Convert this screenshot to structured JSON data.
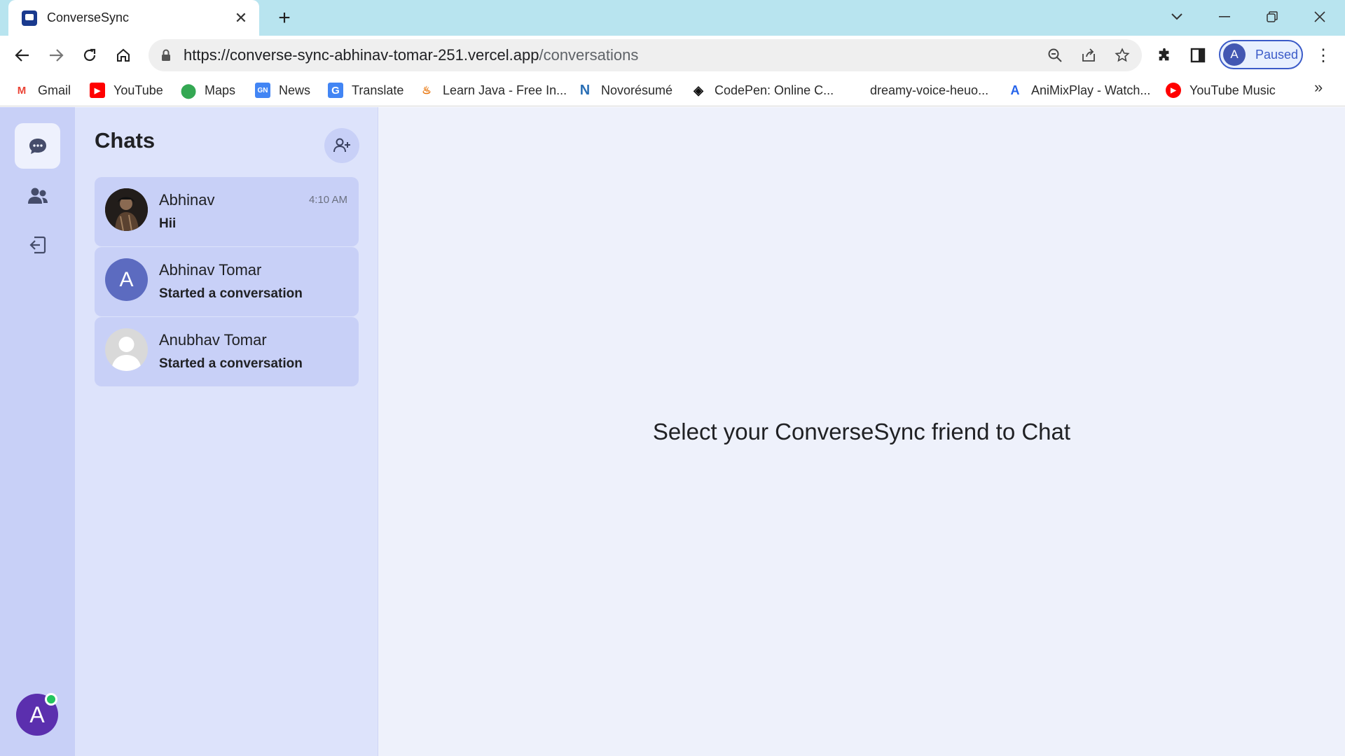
{
  "browser": {
    "tab_title": "ConverseSync",
    "url_host": "https://converse-sync-abhinav-tomar-251.vercel.app",
    "url_path": "/conversations",
    "profile_initial": "A",
    "profile_status": "Paused",
    "bookmarks": [
      {
        "label": "Gmail",
        "icon": "gmail-icon",
        "color": "#ea4335"
      },
      {
        "label": "YouTube",
        "icon": "youtube-icon",
        "color": "#ff0000"
      },
      {
        "label": "Maps",
        "icon": "maps-icon",
        "color": "#34a853"
      },
      {
        "label": "News",
        "icon": "news-icon",
        "color": "#4285f4"
      },
      {
        "label": "Translate",
        "icon": "translate-icon",
        "color": "#4285f4"
      },
      {
        "label": "Learn Java - Free In...",
        "icon": "java-icon",
        "color": "#e76f00"
      },
      {
        "label": "Novorésumé",
        "icon": "novoresume-icon",
        "color": "#2a6fb5"
      },
      {
        "label": "CodePen: Online C...",
        "icon": "codepen-icon",
        "color": "#111111"
      },
      {
        "label": "dreamy-voice-heuo...",
        "icon": "",
        "color": ""
      },
      {
        "label": "AniMixPlay - Watch...",
        "icon": "animixplay-icon",
        "color": "#2563eb"
      },
      {
        "label": "YouTube Music",
        "icon": "youtube-music-icon",
        "color": "#ff0000"
      }
    ]
  },
  "app": {
    "list_title": "Chats",
    "conversations": [
      {
        "name": "Abhinav",
        "last_message": "Hii",
        "time": "4:10 AM",
        "avatar": "photo"
      },
      {
        "name": "Abhinav Tomar",
        "last_message": "Started a conversation",
        "time": "",
        "avatar_initial": "A"
      },
      {
        "name": "Anubhav Tomar",
        "last_message": "Started a conversation",
        "time": "",
        "avatar": "placeholder"
      }
    ],
    "empty_state": "Select your ConverseSync friend to Chat",
    "user_initial": "A",
    "colors": {
      "rail": "#c8d0f7",
      "list_panel": "#dde3fb",
      "conversation_card": "#c8d0f7",
      "main_background": "#eef1fb",
      "user_avatar": "#5b2fae",
      "online": "#22c55e"
    }
  }
}
